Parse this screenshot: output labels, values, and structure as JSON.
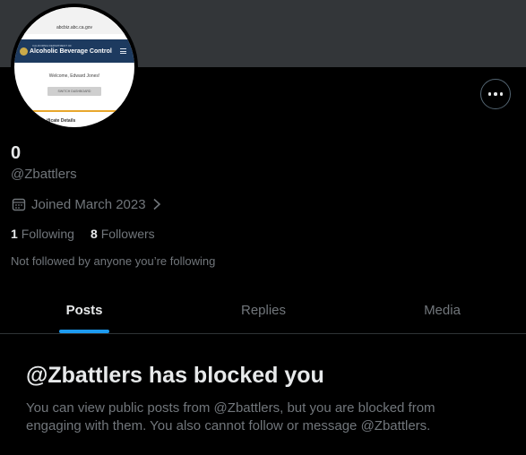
{
  "profile": {
    "display_name": "0",
    "handle": "@Zbattlers",
    "joined": "Joined March 2023",
    "following_count": "1",
    "following_label": "Following",
    "followers_count": "8",
    "followers_label": "Followers",
    "not_followed_text": "Not followed by anyone you’re following"
  },
  "avatar_image": {
    "url_text": "abcbiz.abc.ca.gov",
    "department_text": "CALIFORNIA DEPARTMENT OF",
    "org_title": "Alcoholic Beverage Control",
    "welcome_text": "Welcome, Edward Jones!",
    "button_text": "SWITCH DASHBOARD",
    "section_text": "ificate Details"
  },
  "tabs": [
    {
      "label": "Posts",
      "active": true
    },
    {
      "label": "Replies",
      "active": false
    },
    {
      "label": "Media",
      "active": false
    }
  ],
  "blocked": {
    "title": "@Zbattlers has blocked you",
    "body": "You can view public posts from @Zbattlers, but you are blocked from engaging with them. You also cannot follow or message @Zbattlers."
  },
  "icons": {
    "more": "more-horizontal-icon",
    "calendar": "calendar-icon",
    "chevron": "chevron-right-icon"
  },
  "colors": {
    "background": "#000000",
    "banner": "#333639",
    "accent": "#1d9bf0",
    "primary_text": "#e7e9ea",
    "secondary_text": "#71767b"
  }
}
